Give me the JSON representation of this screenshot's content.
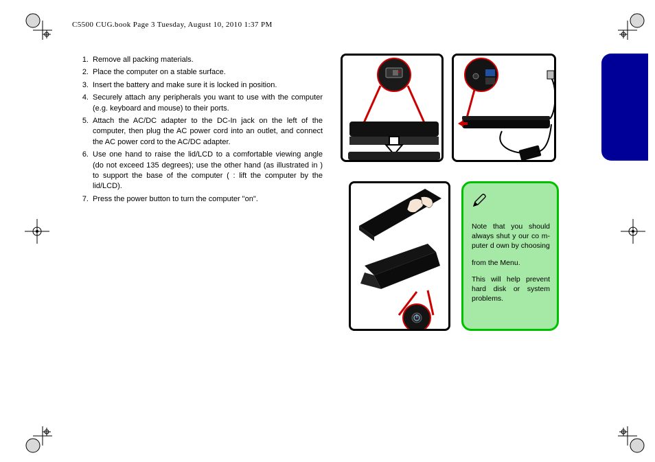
{
  "header": {
    "text": "C5500 CUG.book  Page 3  Tuesday, August 10, 2010  1:37 PM"
  },
  "instructions": [
    {
      "num": "1.",
      "text": "Remove all packing materials."
    },
    {
      "num": "2.",
      "text": "Place the computer on a stable surface."
    },
    {
      "num": "3.",
      "text": "Insert the battery and make sure it is locked in position."
    },
    {
      "num": "4.",
      "text": "Securely attach any peripherals you want to use with the computer (e.g. keyboard and mouse) to their ports."
    },
    {
      "num": "5.",
      "text": "Attach the AC/DC adapter to the DC-In jack on the left of the computer, then plug the AC power cord into an outlet, and connect the AC power cord to the AC/DC adapter."
    },
    {
      "num": "6.",
      "text": "Use one hand to raise the lid/LCD to a comfortable viewing angle (do not exceed 135 degrees); use the other hand (as illustrated in            ) to support the base of the computer (       : lift the computer by the lid/LCD)."
    },
    {
      "num": "7.",
      "text": "Press the power button to turn the computer \"on\"."
    }
  ],
  "note": {
    "p1": "Note that you should always shut y  our co m-puter d      own by choosing",
    "p2": "from the        Menu.",
    "p3": "This will help prevent hard disk  or   system problems."
  }
}
